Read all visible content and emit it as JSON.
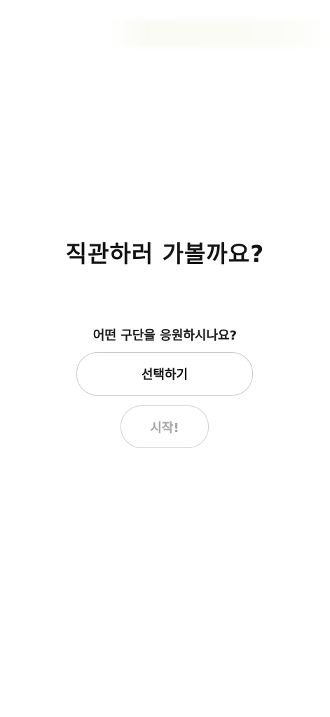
{
  "screen": {
    "title": "직관하러 가볼까요?",
    "prompt": "어떤 구단을 응원하시나요?"
  },
  "buttons": {
    "select_label": "선택하기",
    "start_label": "시작!"
  },
  "colors": {
    "background": "#ffffff",
    "text_primary": "#141414",
    "button_border": "#c9c9c9",
    "disabled_text": "#a6a6a6"
  }
}
